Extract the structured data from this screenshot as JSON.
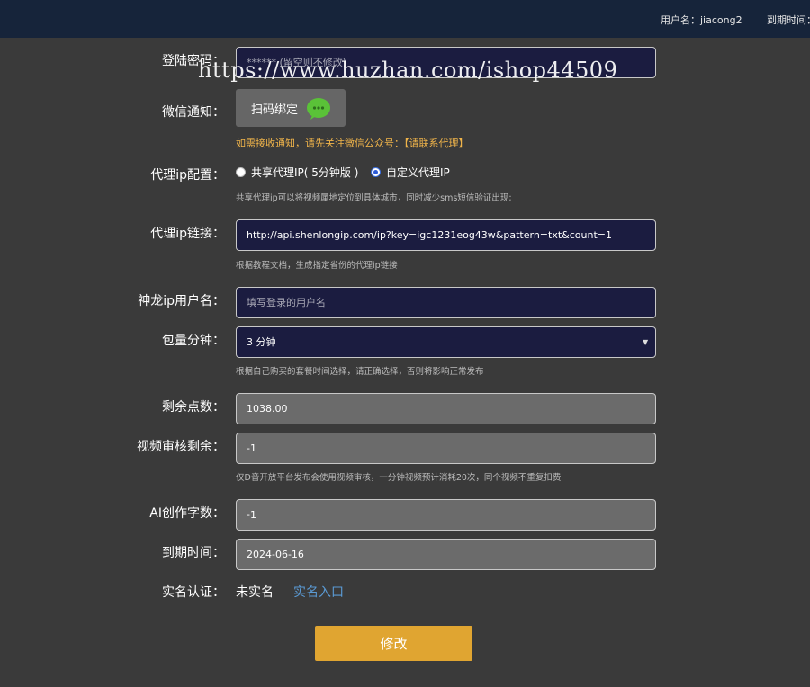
{
  "header": {
    "username": "用户名：jiacong2",
    "expire": "到期时间："
  },
  "watermark": "https://www.huzhan.com/ishop44509",
  "form": {
    "password": {
      "label": "登陆密码：",
      "placeholder": "****** (留空则不修改)"
    },
    "wechat": {
      "label": "微信通知：",
      "button": "扫码绑定",
      "notice": "如需接收通知，请先关注微信公众号：【请联系代理】"
    },
    "proxy_config": {
      "label": "代理ip配置：",
      "option_shared": "共享代理IP( 5分钟版 )",
      "option_custom": "自定义代理IP",
      "selected": "自定义代理IP",
      "hint": "共享代理ip可以将视频属地定位到具体城市，同时减少sms短信验证出现;"
    },
    "proxy_link": {
      "label": "代理ip链接：",
      "value": "http://api.shenlongip.com/ip?key=igc1231eog43w&pattern=txt&count=1",
      "hint": "根据教程文档，生成指定省份的代理ip链接"
    },
    "shenlong_user": {
      "label": "神龙ip用户名：",
      "placeholder": "填写登录的用户名"
    },
    "package": {
      "label": "包量分钟：",
      "value": "3 分钟",
      "hint": "根据自己购买的套餐时间选择，请正确选择，否则将影响正常发布"
    },
    "points": {
      "label": "剩余点数：",
      "value": "1038.00"
    },
    "video_review": {
      "label": "视频审核剩余：",
      "value": "-1",
      "hint": "仅D音开放平台发布会使用视频审核，一分钟视频预计消耗20次，同个视频不重复扣费"
    },
    "ai_words": {
      "label": "AI创作字数：",
      "value": "-1"
    },
    "expire_date": {
      "label": "到期时间：",
      "value": "2024-06-16"
    },
    "realname": {
      "label": "实名认证：",
      "status": "未实名",
      "link": "实名入口"
    },
    "submit": "修改"
  },
  "colors": {
    "accent": "#e0a531",
    "input_dark": "#1b1c40",
    "link": "#5b9bd5",
    "notice": "#f0b44a"
  }
}
